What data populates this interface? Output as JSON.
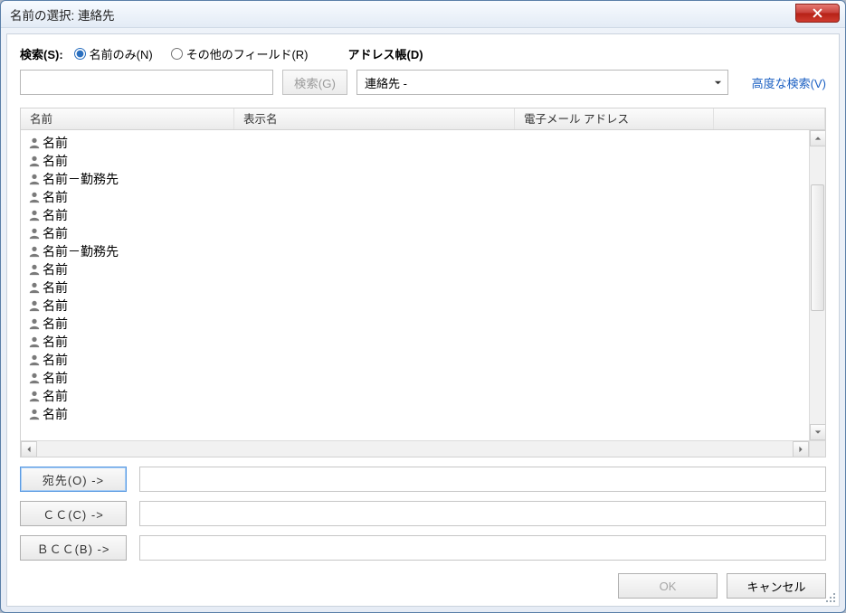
{
  "title": "名前の選択: 連絡先",
  "search": {
    "label": "検索(S):",
    "radio_name_only": "名前のみ(N)",
    "radio_other": "その他のフィールド(R)",
    "button": "検索(G)",
    "value": ""
  },
  "address_book": {
    "label": "アドレス帳(D)",
    "selected": "連絡先 -"
  },
  "advanced_search": "高度な検索(V)",
  "columns": {
    "name": "名前",
    "display": "表示名",
    "email": "電子メール アドレス"
  },
  "contacts": [
    {
      "label": "名前"
    },
    {
      "label": "名前"
    },
    {
      "label": "名前－勤務先"
    },
    {
      "label": "名前"
    },
    {
      "label": "名前"
    },
    {
      "label": "名前"
    },
    {
      "label": "名前－勤務先"
    },
    {
      "label": "名前"
    },
    {
      "label": "名前"
    },
    {
      "label": "名前"
    },
    {
      "label": "名前"
    },
    {
      "label": "名前"
    },
    {
      "label": "名前"
    },
    {
      "label": "名前"
    },
    {
      "label": "名前"
    },
    {
      "label": "名前"
    }
  ],
  "recipients": {
    "to": {
      "button": "宛先(O) ->",
      "value": ""
    },
    "cc": {
      "button": "ＣＣ(C) ->",
      "value": ""
    },
    "bcc": {
      "button": "ＢＣＣ(B) ->",
      "value": ""
    }
  },
  "buttons": {
    "ok": "OK",
    "cancel": "キャンセル"
  }
}
